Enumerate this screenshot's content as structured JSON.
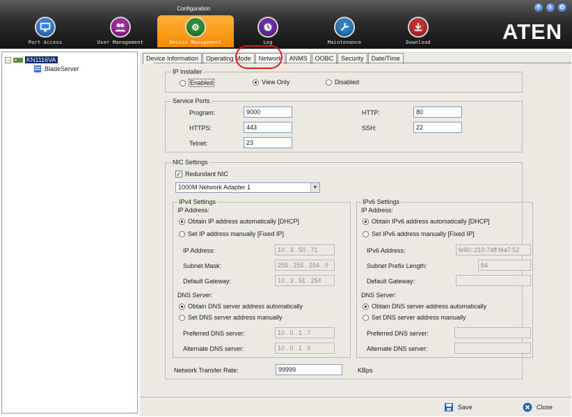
{
  "header": {
    "config_label": "Configuration",
    "nav": [
      {
        "label": "Port Access",
        "icon": "monitor-icon",
        "color": "#3c7de0"
      },
      {
        "label": "User Management",
        "icon": "users-icon",
        "color": "#9b2b9b"
      },
      {
        "label": "Device Management",
        "icon": "device-icon",
        "color": "#2f8f2f"
      },
      {
        "label": "Log",
        "icon": "log-icon",
        "color": "#6b2fa0"
      },
      {
        "label": "Maintenance",
        "icon": "wrench-icon",
        "color": "#2f7fc0"
      },
      {
        "label": "Download",
        "icon": "download-icon",
        "color": "#c03030"
      }
    ],
    "active_nav": "Device Management",
    "logo": "ATEN",
    "accent_color": "#f08a00"
  },
  "tree": {
    "root": "KN1116VA",
    "child": "BladeServer"
  },
  "tabs": [
    "Device Information",
    "Operating Mode",
    "Network",
    "ANMS",
    "OOBC",
    "Security",
    "Date/Time"
  ],
  "active_tab": "Network",
  "ip_installer": {
    "legend": "IP Installer",
    "options": [
      "Enabled",
      "View Only",
      "Disabled"
    ],
    "selected": "View Only"
  },
  "service_ports": {
    "legend": "Service Ports",
    "program_label": "Program:",
    "program": "9000",
    "https_label": "HTTPS:",
    "https": "443",
    "telnet_label": "Telnet:",
    "telnet": "23",
    "http_label": "HTTP:",
    "http": "80",
    "ssh_label": "SSH:",
    "ssh": "22"
  },
  "nic": {
    "legend": "NIC Settings",
    "redundant_label": "Redundant NIC",
    "redundant_checked": true,
    "adapter": "1000M Network Adapter 1"
  },
  "ipv4": {
    "legend": "IPv4 Settings",
    "ip_address_heading": "IP Address:",
    "auto_label": "Obtain IP address automatically [DHCP]",
    "manual_label": "Set IP address manually [Fixed IP]",
    "ip_label": "IP Address:",
    "ip_value": "10 . 3 . 50 . 71",
    "mask_label": "Subnet Mask:",
    "mask_value": "255 . 255 . 254 . 0",
    "gateway_label": "Default Gateway:",
    "gateway_value": "10 . 3 . 51 . 254",
    "dns_heading": "DNS Server:",
    "dns_auto_label": "Obtain DNS server address automatically",
    "dns_manual_label": "Set DNS server address manually",
    "pref_dns_label": "Preferred DNS server:",
    "pref_dns_value": "10 . 0 . 1 . 7",
    "alt_dns_label": "Alternate DNS server:",
    "alt_dns_value": "10 . 0 . 1 . 6"
  },
  "ipv6": {
    "legend": "IPv6 Settings",
    "ip_address_heading": "IP Address:",
    "auto_label": "Obtain IPv6 address automatically [DHCP]",
    "manual_label": "Set IPv6 address manually [Fixed IP]",
    "ip_label": "IPv6 Address:",
    "ip_value": "fe80::210:74ff:fea7:52",
    "prefix_label": "Subnet Prefix Length:",
    "prefix_value": "64",
    "gateway_label": "Default Gateway:",
    "gateway_value": "",
    "dns_heading": "DNS Server:",
    "dns_auto_label": "Obtain DNS server address automatically",
    "dns_manual_label": "Set DNS server address manually",
    "pref_dns_label": "Preferred DNS server:",
    "pref_dns_value": "",
    "alt_dns_label": "Alternate DNS server:",
    "alt_dns_value": ""
  },
  "transfer": {
    "label": "Network Transfer Rate:",
    "value": "99999",
    "unit": "KBps"
  },
  "footer": {
    "save_label": "Save",
    "close_label": "Close"
  }
}
